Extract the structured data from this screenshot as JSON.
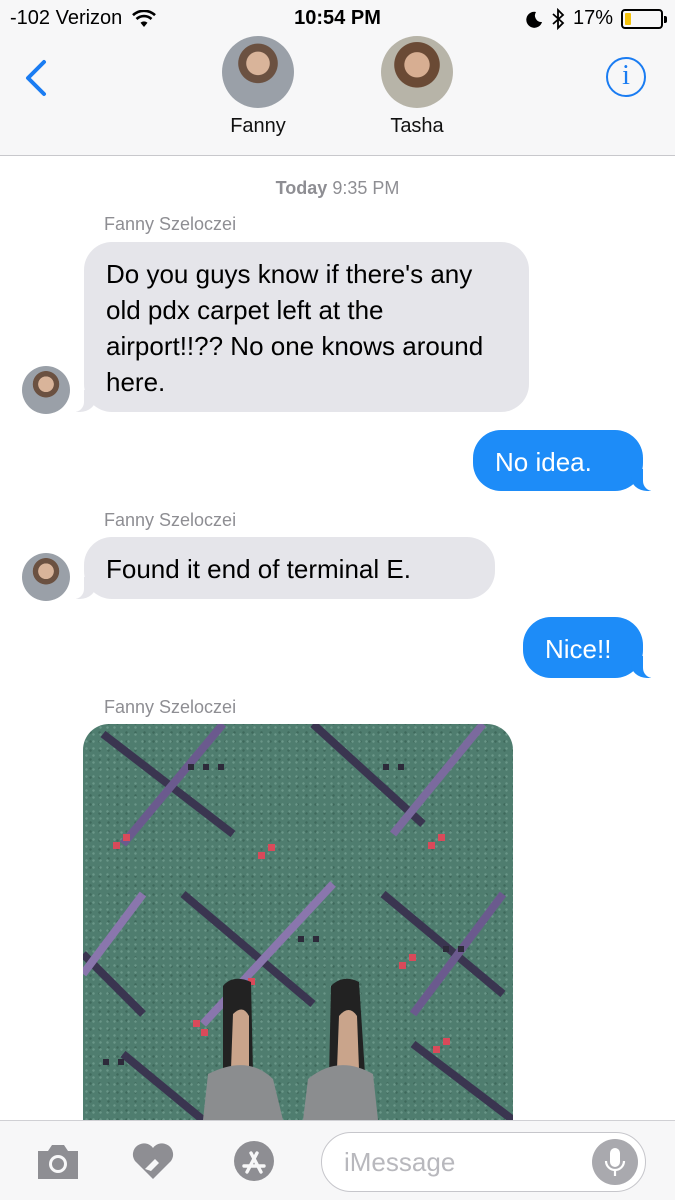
{
  "status": {
    "carrier": "-102 Verizon",
    "time": "10:54 PM",
    "battery": "17%",
    "battery_fraction": 0.17
  },
  "header": {
    "contacts": [
      {
        "name": "Fanny"
      },
      {
        "name": "Tasha"
      }
    ],
    "back_icon": "chevron-left-icon",
    "info_icon": "info-icon"
  },
  "thread": {
    "timestamp_day": "Today",
    "timestamp_time": "9:35 PM",
    "messages": [
      {
        "sender": "Fanny Szeloczei",
        "text": "Do you guys know if there's any old pdx carpet left at the airport!!?? No one knows around here.",
        "direction": "incoming"
      },
      {
        "text": "No idea.",
        "direction": "outgoing"
      },
      {
        "sender": "Fanny Szeloczei",
        "text": "Found it end of terminal E.",
        "direction": "incoming"
      },
      {
        "text": "Nice!!",
        "direction": "outgoing"
      },
      {
        "sender": "Fanny Szeloczei",
        "type": "photo",
        "direction": "incoming"
      }
    ]
  },
  "composer": {
    "placeholder": "iMessage",
    "icons": [
      "camera-icon",
      "digital-touch-icon",
      "app-store-icon",
      "microphone-icon"
    ]
  },
  "colors": {
    "ios_blue": "#1d8cf8",
    "incoming_bubble": "#e5e5ea",
    "battery_fill": "#f4c20d"
  }
}
